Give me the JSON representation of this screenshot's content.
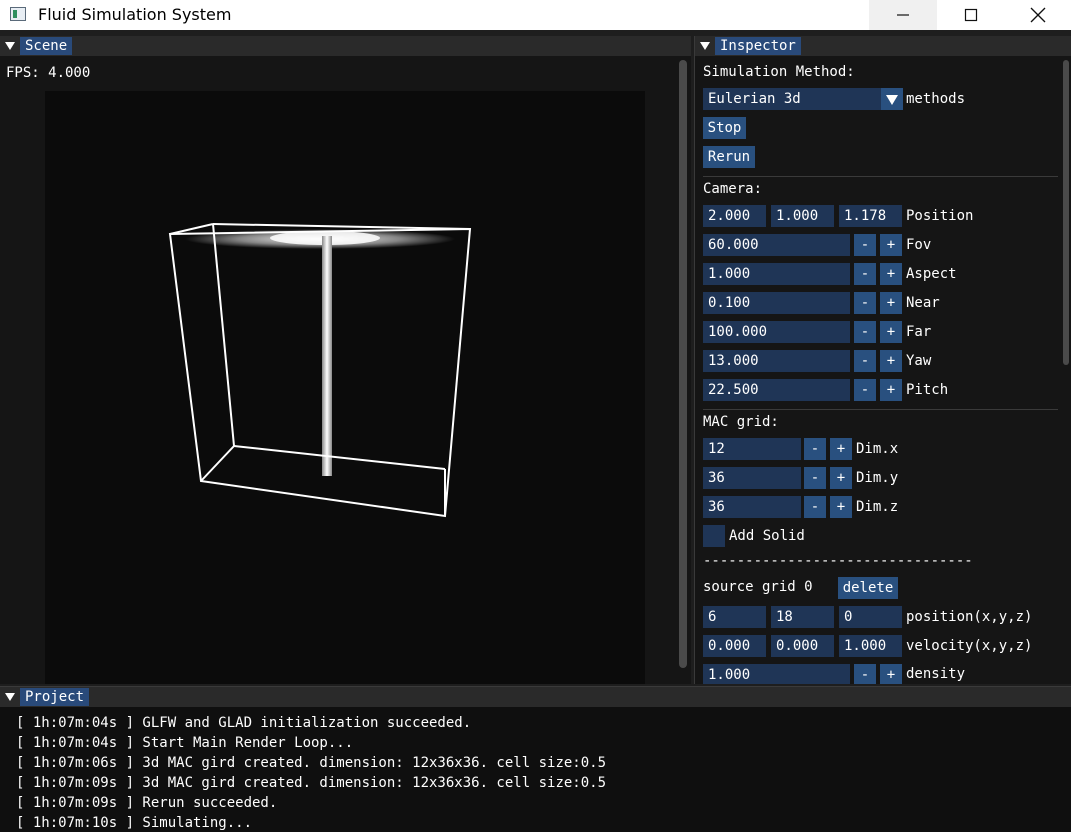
{
  "window": {
    "title": "Fluid Simulation System"
  },
  "scene": {
    "tab": "Scene",
    "fps": "FPS: 4.000"
  },
  "inspector": {
    "tab": "Inspector",
    "simulation_method_label": "Simulation Method:",
    "method_value": "Eulerian 3d",
    "method_suffix": "methods",
    "stop_label": "Stop",
    "rerun_label": "Rerun",
    "camera_label": "Camera:",
    "position": {
      "x": "2.000",
      "y": "1.000",
      "z": "1.178",
      "label": "Position"
    },
    "camera_rows": [
      {
        "value": "60.000",
        "label": "Fov"
      },
      {
        "value": "1.000",
        "label": "Aspect"
      },
      {
        "value": "0.100",
        "label": "Near"
      },
      {
        "value": "100.000",
        "label": "Far"
      },
      {
        "value": "13.000",
        "label": "Yaw"
      },
      {
        "value": "22.500",
        "label": "Pitch"
      }
    ],
    "mac_label": "MAC grid:",
    "dim_rows": [
      {
        "value": "12",
        "label": "Dim.x"
      },
      {
        "value": "36",
        "label": "Dim.y"
      },
      {
        "value": "36",
        "label": "Dim.z"
      }
    ],
    "add_solid_label": "Add Solid",
    "dashes": "--------------------------------",
    "source_label": "source grid 0",
    "delete_label": "delete",
    "source_position": {
      "x": "6",
      "y": "18",
      "z": "0",
      "label": "position(x,y,z)"
    },
    "source_velocity": {
      "x": "0.000",
      "y": "0.000",
      "z": "1.000",
      "label": "velocity(x,y,z)"
    },
    "density": {
      "value": "1.000",
      "label": "density"
    },
    "minus": "-",
    "plus": "+"
  },
  "project": {
    "tab": "Project",
    "logs": [
      "[ 1h:07m:04s ] GLFW and GLAD initialization succeeded.",
      "[ 1h:07m:04s ] Start Main Render Loop...",
      "[ 1h:07m:06s ] 3d MAC gird created. dimension: 12x36x36. cell size:0.5",
      "[ 1h:07m:09s ] 3d MAC gird created. dimension: 12x36x36. cell size:0.5",
      "[ 1h:07m:09s ] Rerun succeeded.",
      "[ 1h:07m:10s ] Simulating..."
    ]
  }
}
